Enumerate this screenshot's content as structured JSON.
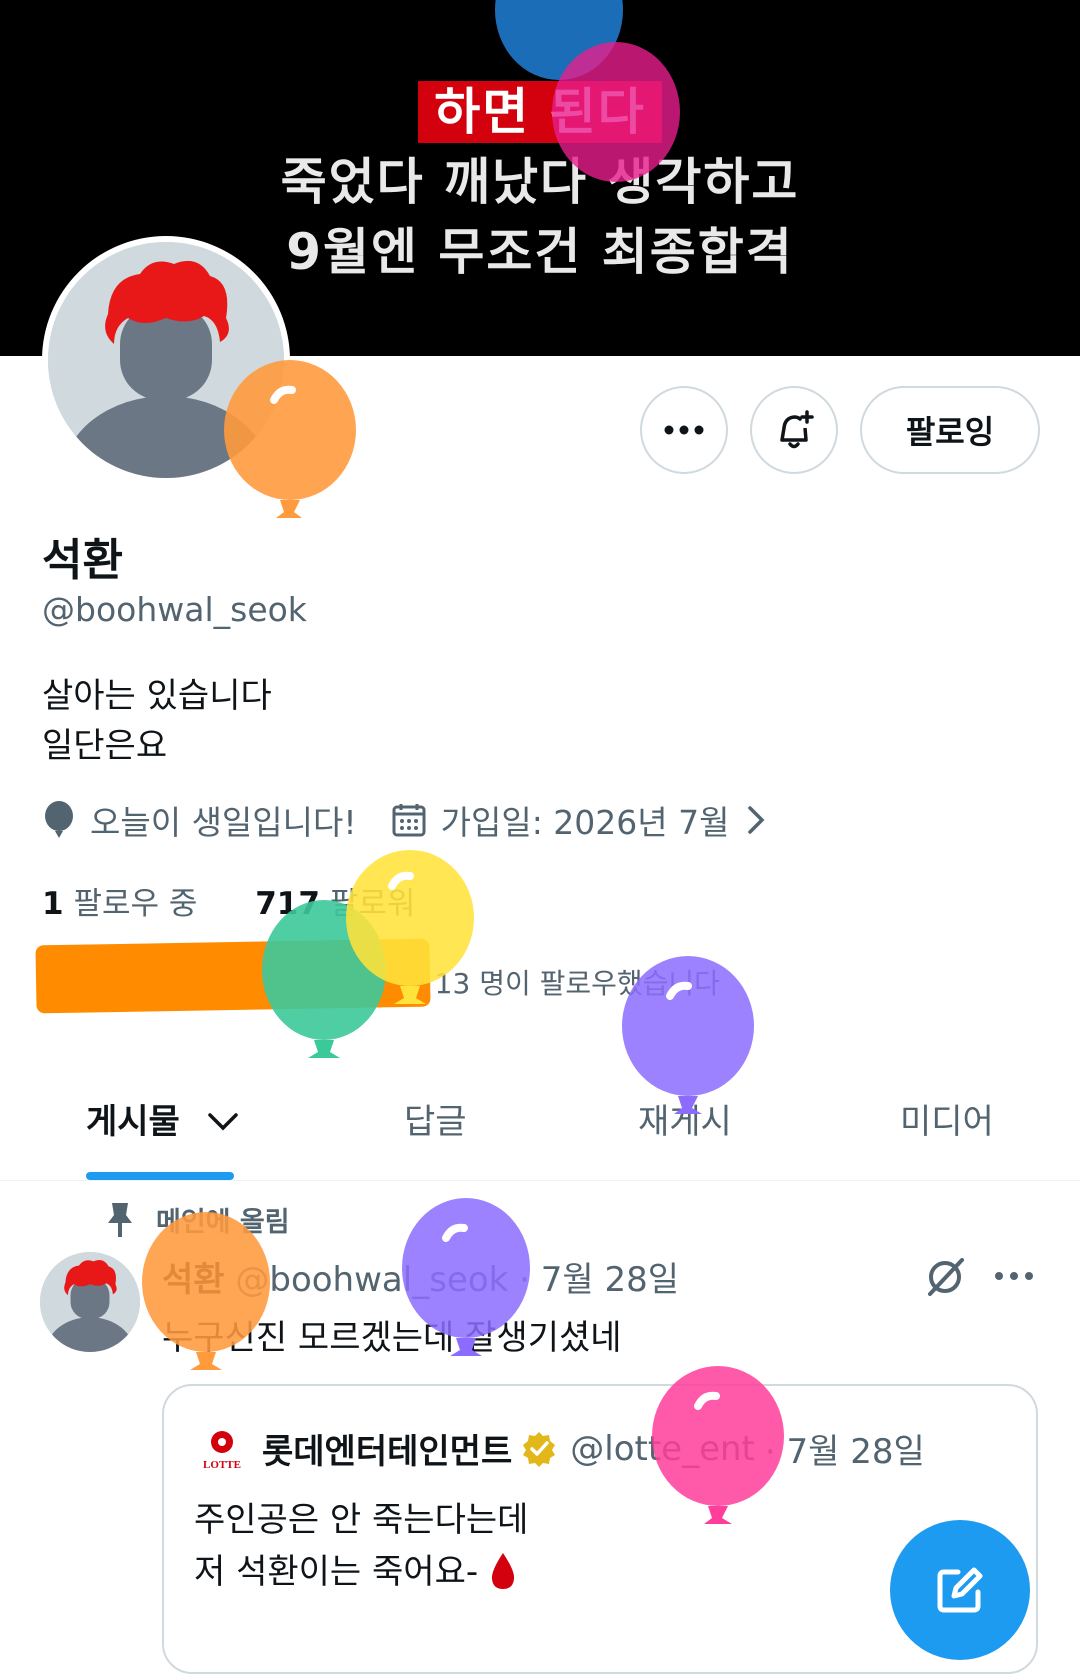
{
  "banner": {
    "line1": "하면 된다",
    "line2": "죽었다 깨났다 생각하고",
    "line3": "9월엔 무조건 최종합격"
  },
  "profile": {
    "display_name": "석환",
    "handle": "@boohwal_seok",
    "bio_line1": "살아는 있습니다",
    "bio_line2": "일단은요",
    "birthday": "오늘이 생일입니다!",
    "joined": "가입일: 2026년 7월",
    "following_count": "1",
    "following_label": "팔로우 중",
    "followers_count": "717",
    "followers_label": "팔로워",
    "followers_known": "외 13 명이 팔로우했습니다"
  },
  "actions": {
    "following_button": "팔로잉"
  },
  "tabs": {
    "posts": "게시물",
    "replies": "답글",
    "reposts": "재게시",
    "media": "미디어"
  },
  "tweet": {
    "pinned_label": "메인에 올림",
    "author": "석환",
    "handle": "@boohwal_seok",
    "date": "· 7월 28일",
    "text": "누구신진 모르겠는데 잘생기셨네",
    "quote": {
      "author": "롯데엔터테인먼트",
      "handle": "@lotte_ent",
      "date": "· 7월 28일",
      "line1": "주인공은 안 죽는다는데",
      "line2": "저 석환이는 죽어요-",
      "logo_text": "LOTTE"
    }
  },
  "colors": {
    "accent": "#1d9bf0",
    "banner_highlight": "#d3000d",
    "avatar_hair": "#e81818",
    "redaction": "#ff8c00"
  }
}
